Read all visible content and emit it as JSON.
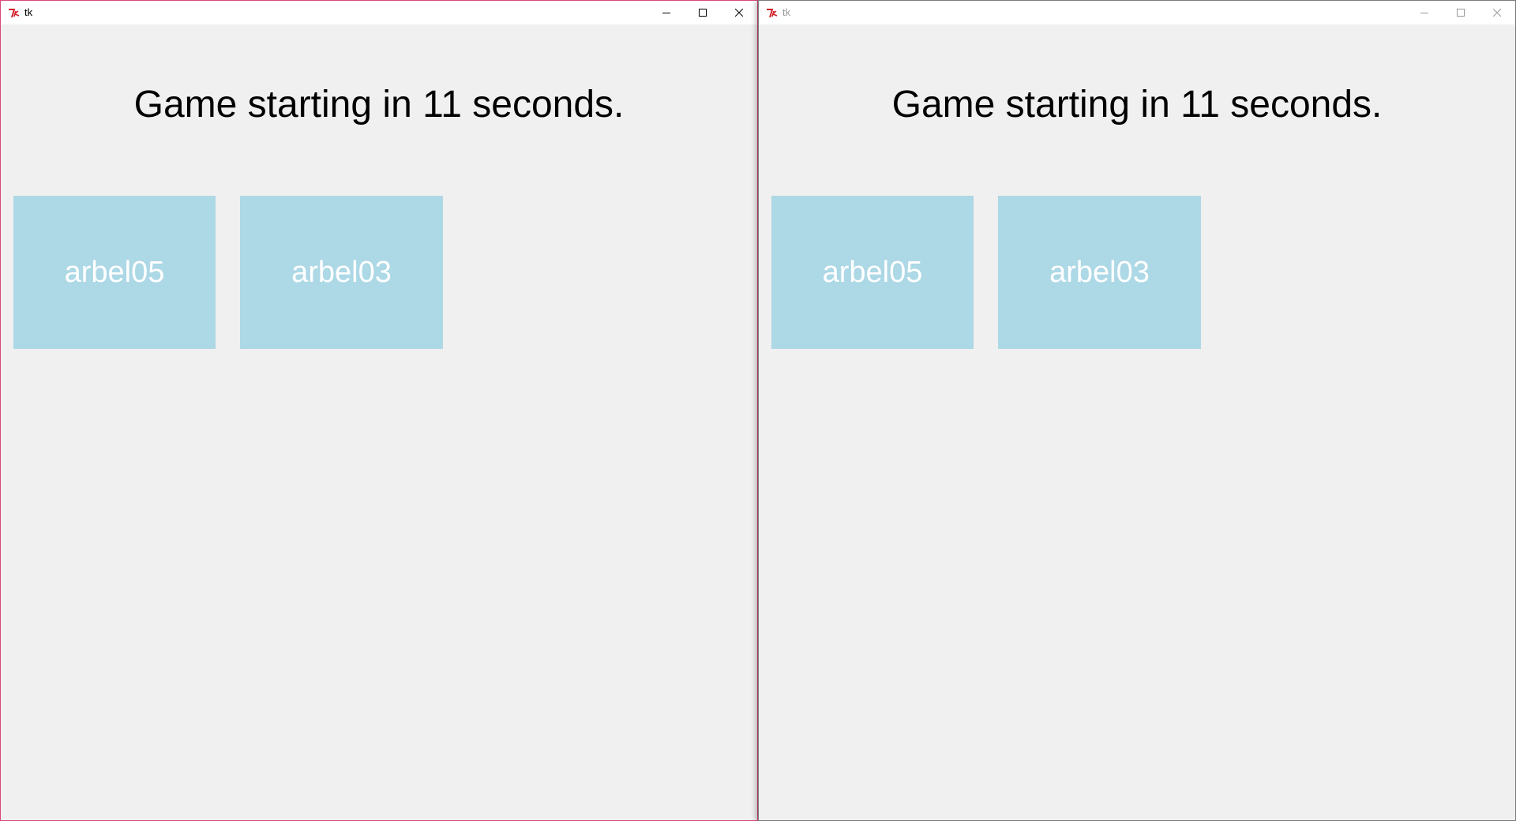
{
  "windows": [
    {
      "title": "tk",
      "focused": true,
      "message": "Game starting in 11 seconds.",
      "players": [
        "arbel05",
        "arbel03"
      ]
    },
    {
      "title": "tk",
      "focused": false,
      "message": "Game starting in 11 seconds.",
      "players": [
        "arbel05",
        "arbel03"
      ]
    }
  ],
  "icons": {
    "app": "tk-feather-icon",
    "minimize": "minimize-icon",
    "maximize": "maximize-icon",
    "close": "close-icon"
  },
  "colors": {
    "background": "#f0f0f0",
    "card": "#add8e6",
    "card_text": "#ffffff",
    "active_border": "#d9477a",
    "inactive_title": "#999999"
  }
}
